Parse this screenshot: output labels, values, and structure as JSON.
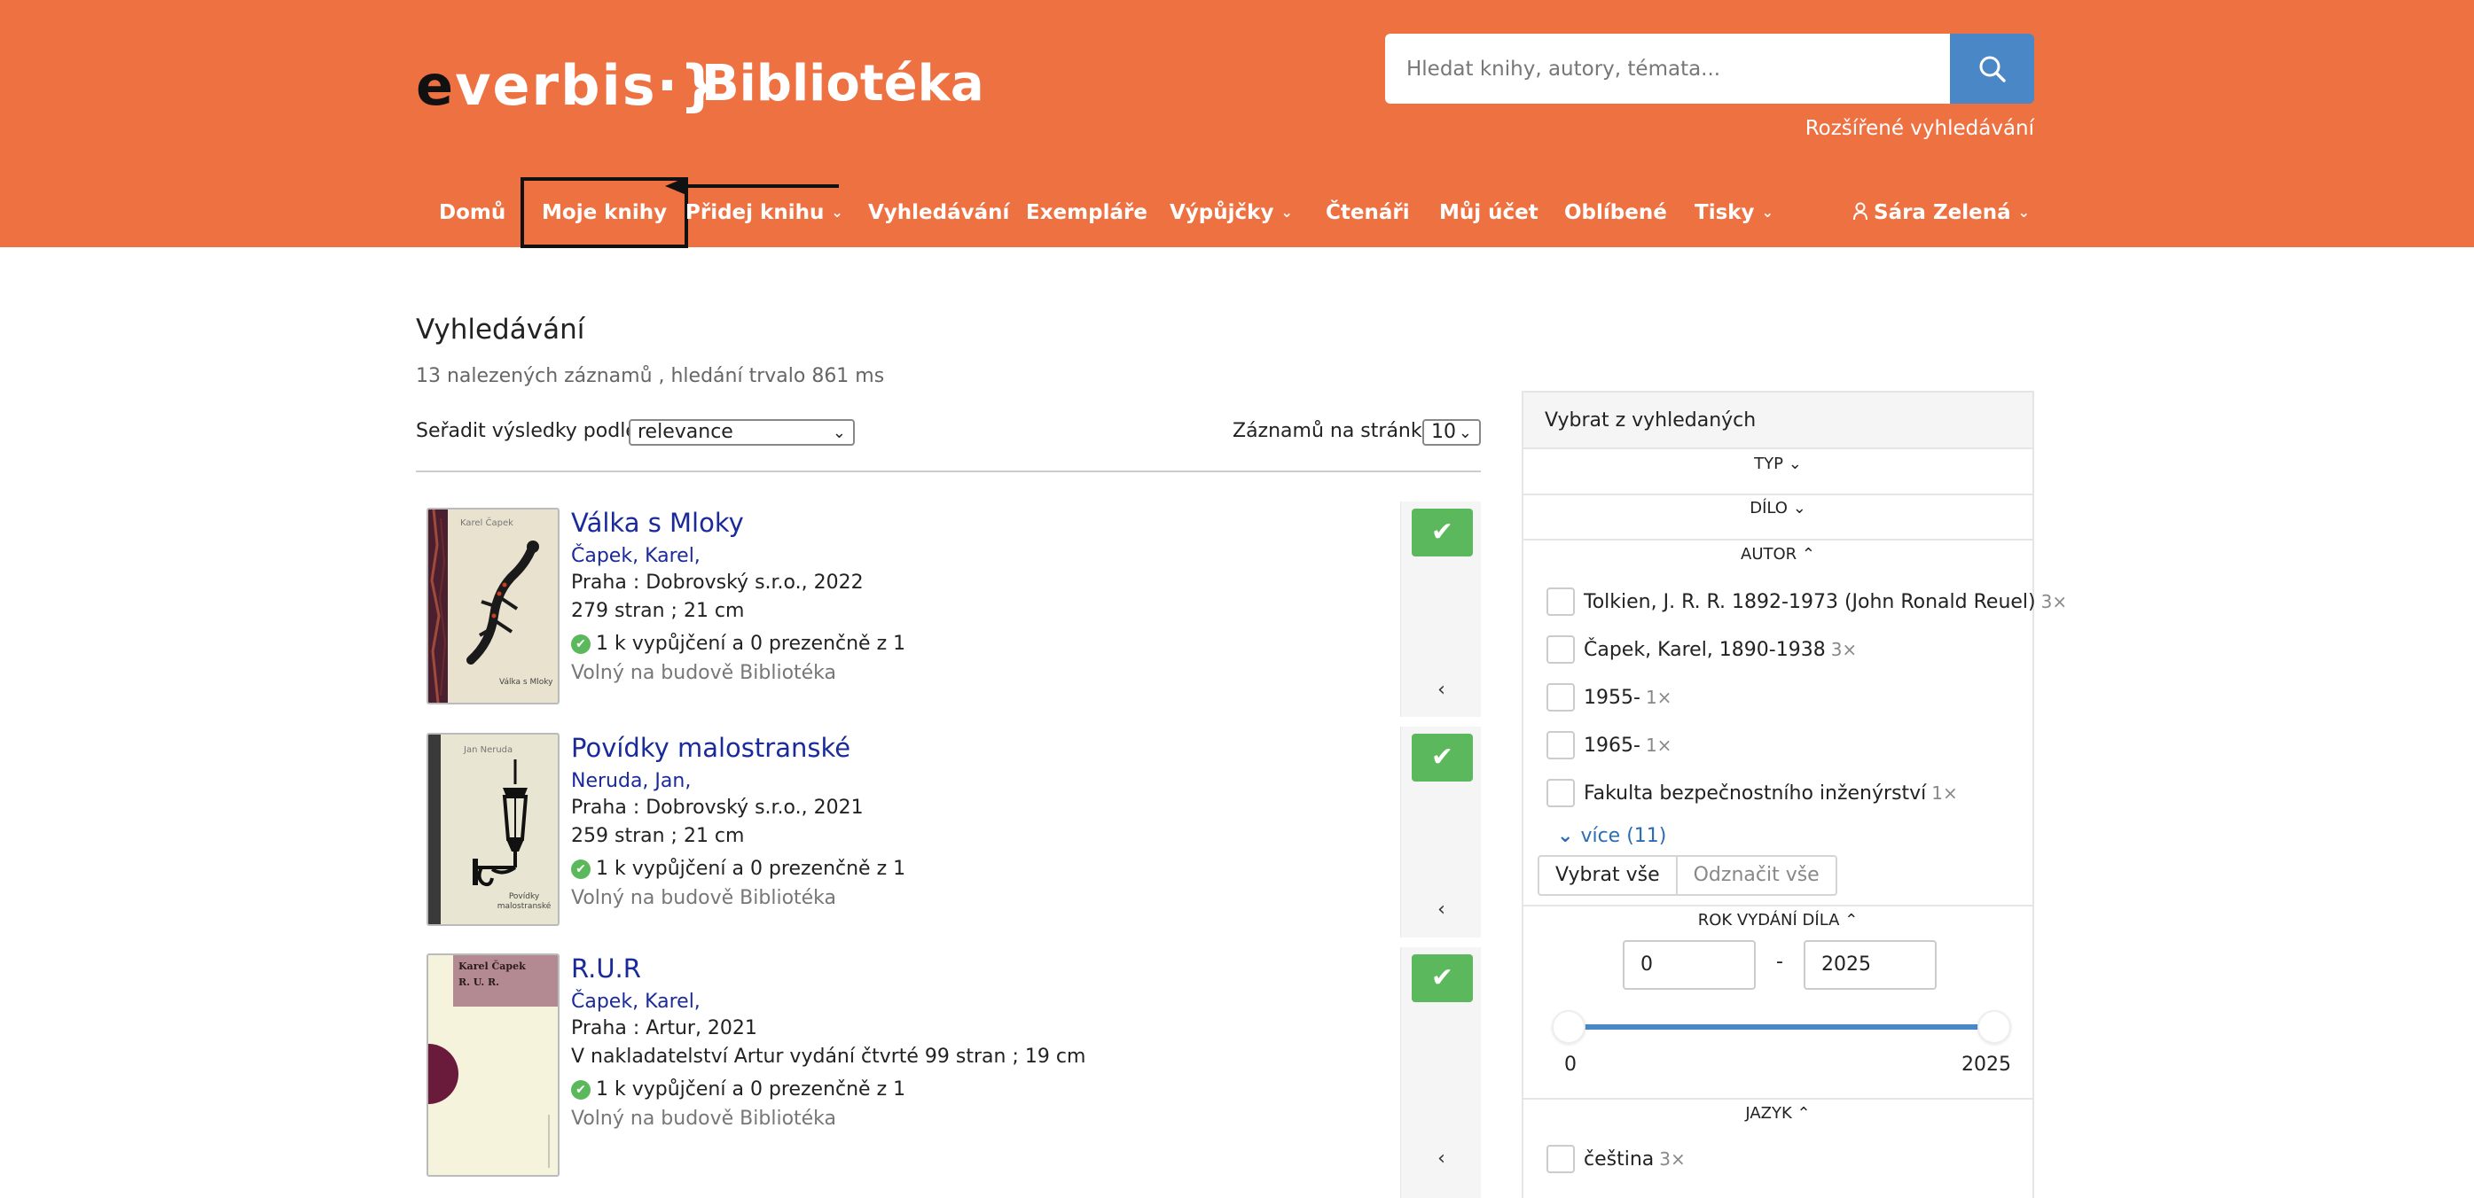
{
  "header": {
    "logo_first": "e",
    "logo_rest": "verbis",
    "logo_brace": "·}",
    "site_title": "Bibliotéka",
    "search_placeholder": "Hledat knihy, autory, témata...",
    "advanced_search": "Rozšířené vyhledávání"
  },
  "nav": {
    "items": [
      {
        "label": "Domů",
        "dropdown": false
      },
      {
        "label": "Moje knihy",
        "dropdown": false,
        "highlighted": true
      },
      {
        "label": "Přidej knihu",
        "dropdown": true
      },
      {
        "label": "Vyhledávání",
        "dropdown": false
      },
      {
        "label": "Exempláře",
        "dropdown": false
      },
      {
        "label": "Výpůjčky",
        "dropdown": true
      },
      {
        "label": "Čtenáři",
        "dropdown": false
      },
      {
        "label": "Můj účet",
        "dropdown": false
      },
      {
        "label": "Oblíbené",
        "dropdown": false
      },
      {
        "label": "Tisky",
        "dropdown": true
      }
    ],
    "user": "Sára Zelená"
  },
  "main": {
    "heading": "Vyhledávání",
    "results_info": "13 nalezených záznamů , hledání trvalo 861 ms",
    "sort_label": "Seřadit výsledky podle:",
    "sort_value": "relevance",
    "per_page_label": "Záznamů na stránku:",
    "per_page_value": "10"
  },
  "results": [
    {
      "title": "Válka s Mloky",
      "author": "Čapek, Karel,",
      "publisher": "Praha : Dobrovský s.r.o., 2022",
      "extent": "279 stran ; 21 cm",
      "availability": "1 k vypůjčení a 0 prezenčně z 1",
      "location": "Volný na budově Bibliotéka",
      "cover_author": "Karel Čapek",
      "cover_title": "Válka s Mloky"
    },
    {
      "title": "Povídky malostranské",
      "author": "Neruda, Jan,",
      "publisher": "Praha : Dobrovský s.r.o., 2021",
      "extent": "259 stran ; 21 cm",
      "availability": "1 k vypůjčení a 0 prezenčně z 1",
      "location": "Volný na budově Bibliotéka",
      "cover_author": "Jan Neruda",
      "cover_title": "Povídky malostranské"
    },
    {
      "title": "R.U.R",
      "author": "Čapek, Karel,",
      "publisher": "Praha : Artur, 2021",
      "extent": "V nakladatelství Artur vydání čtvrté 99 stran ; 19 cm",
      "availability": "1 k vypůjčení a 0 prezenčně z 1",
      "location": "Volný na budově Bibliotéka",
      "cover_author": "Karel Čapek",
      "cover_title": "R. U. R."
    }
  ],
  "sidebar": {
    "title": "Vybrat z vyhledaných",
    "facet_type": "TYP",
    "facet_work": "DÍLO",
    "facet_author": "AUTOR",
    "author_options": [
      {
        "label": "Tolkien, J. R. R. 1892-1973 (John Ronald Reuel)",
        "count": "3×"
      },
      {
        "label": "Čapek, Karel, 1890-1938",
        "count": "3×"
      },
      {
        "label": "1955-",
        "count": "1×"
      },
      {
        "label": "1965-",
        "count": "1×"
      },
      {
        "label": "Fakulta bezpečnostního inženýrství",
        "count": "1×"
      }
    ],
    "more": "více (11)",
    "select_all": "Vybrat vše",
    "deselect_all": "Odznačit vše",
    "facet_year": "ROK VYDÁNÍ DÍLA",
    "year_from": "0",
    "year_to": "2025",
    "year_min_label": "0",
    "year_max_label": "2025",
    "facet_language": "JAZYK",
    "language_options": [
      {
        "label": "čeština",
        "count": "3×"
      }
    ]
  },
  "colors": {
    "header_bg": "#ee7142",
    "search_button": "#4a87c6",
    "link": "#1a2a9a",
    "success": "#5cb85c"
  }
}
